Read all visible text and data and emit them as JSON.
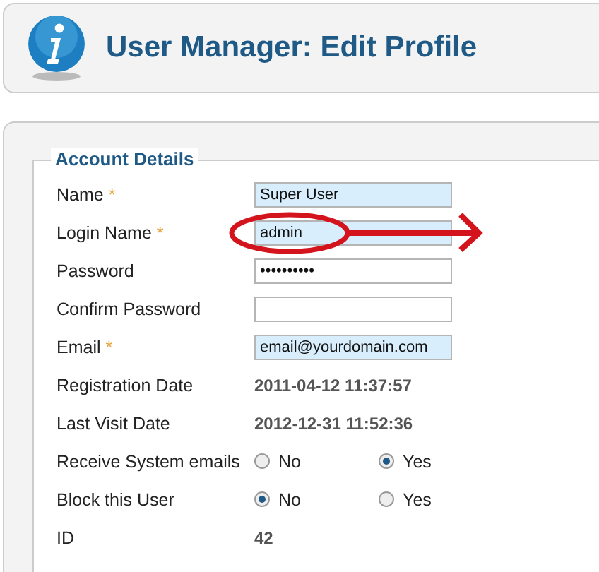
{
  "header": {
    "title": "User Manager: Edit Profile"
  },
  "fieldset": {
    "legend": "Account Details"
  },
  "fields": [
    {
      "kind": "text",
      "label": "Name",
      "mark": "*",
      "highlighted": true,
      "value": "Super User"
    },
    {
      "kind": "text",
      "label": "Login Name",
      "mark": "*",
      "highlighted": true,
      "value": "admin",
      "circled": true
    },
    {
      "kind": "text",
      "label": "Password",
      "highlighted": false,
      "value": "••••••••••"
    },
    {
      "kind": "text",
      "label": "Confirm Password",
      "highlighted": false
    },
    {
      "kind": "text",
      "label": "Email",
      "mark": "*",
      "highlighted": true,
      "value": "email@yourdomain.com"
    },
    {
      "kind": "static",
      "label": "Registration Date",
      "value": "2011-04-12 11:37:57"
    },
    {
      "kind": "static",
      "label": "Last Visit Date",
      "value": "2012-12-31 11:52:36"
    },
    {
      "kind": "radio",
      "label": "Receive System emails",
      "options": [
        {
          "label": "No",
          "selected": false
        },
        {
          "label": "Yes",
          "selected": true
        }
      ]
    },
    {
      "kind": "radio",
      "label": "Block this User",
      "options": [
        {
          "label": "No",
          "selected": true
        },
        {
          "label": "Yes",
          "selected": false
        }
      ]
    },
    {
      "kind": "static",
      "label": "ID",
      "value": "42"
    }
  ]
}
